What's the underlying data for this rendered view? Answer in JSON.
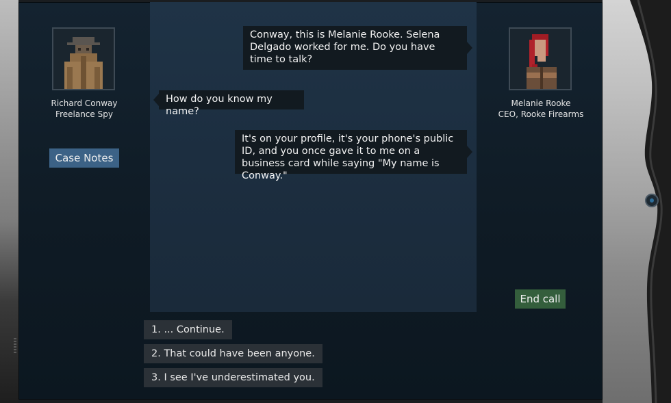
{
  "speakers": {
    "left": {
      "name": "Richard Conway",
      "title": "Freelance Spy",
      "icon": "detective-portrait-icon"
    },
    "right": {
      "name": "Melanie Rooke",
      "title": "CEO, Rooke Firearms",
      "icon": "redhead-portrait-icon"
    }
  },
  "buttons": {
    "case_notes": "Case Notes",
    "end_call": "End call"
  },
  "messages": [
    {
      "speaker": "Melanie Rooke",
      "side": "right",
      "text": "Conway, this is Melanie Rooke. Selena Delgado worked for me. Do you have time to talk?"
    },
    {
      "speaker": "Richard Conway",
      "side": "left",
      "text": "How do you know my name?"
    },
    {
      "speaker": "Melanie Rooke",
      "side": "right",
      "text": "It's on your profile, it's your phone's public ID, and you once gave it to me on a business card while saying \"My name is Conway.\""
    }
  ],
  "choices": [
    "1. ... Continue.",
    "2. That could have been anyone.",
    "3. I see I've underestimated you."
  ],
  "colors": {
    "case_notes_bg": "#3c6286",
    "end_call_bg": "#345e3c",
    "bubble_bg": "#121a20",
    "choice_bg": "#2b3137"
  }
}
